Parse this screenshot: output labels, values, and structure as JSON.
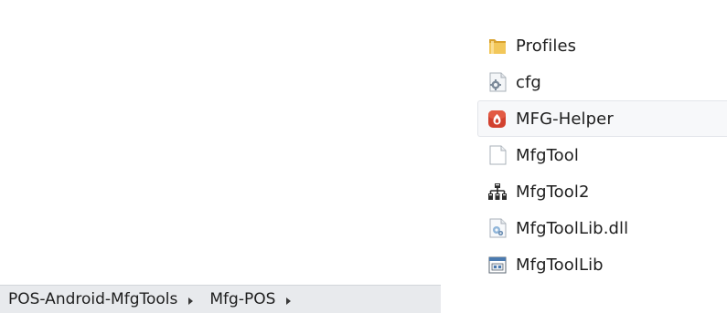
{
  "files": [
    {
      "label": "Profiles",
      "icon": "folder-icon"
    },
    {
      "label": "cfg",
      "icon": "config-file-icon"
    },
    {
      "label": "MFG-Helper",
      "icon": "mfg-helper-app-icon"
    },
    {
      "label": "MfgTool",
      "icon": "text-file-icon"
    },
    {
      "label": "MfgTool2",
      "icon": "network-app-icon"
    },
    {
      "label": "MfgToolLib.dll",
      "icon": "dll-file-icon"
    },
    {
      "label": "MfgToolLib",
      "icon": "library-file-icon"
    }
  ],
  "breadcrumb": {
    "items": [
      "POS-Android-MfgTools",
      "Mfg-POS"
    ]
  },
  "colors": {
    "folder": "#e8b53d",
    "mfg_helper": "#d2412f",
    "breadcrumb_bg": "#e8eaed",
    "hover_bg": "#f7f8fa"
  }
}
